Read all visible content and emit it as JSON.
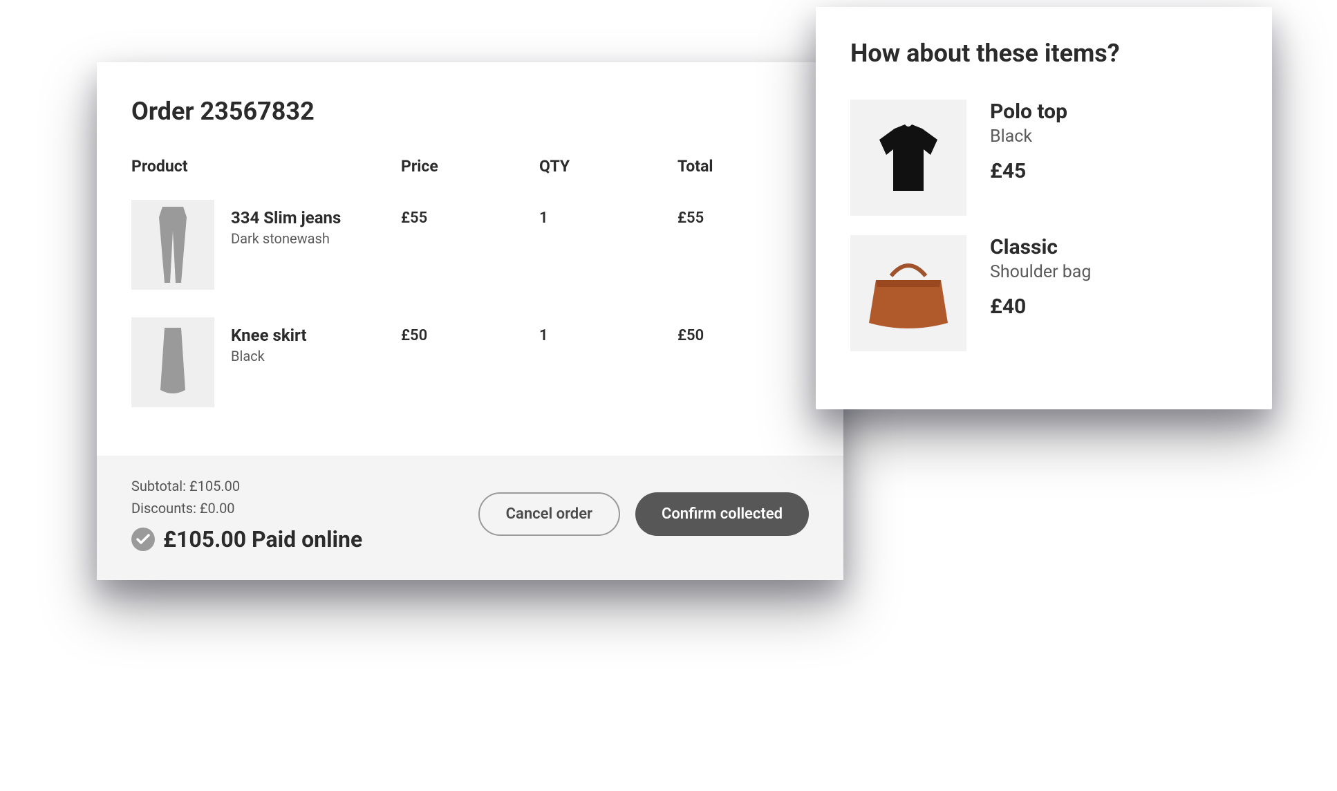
{
  "order": {
    "title": "Order 23567832",
    "columns": {
      "product": "Product",
      "price": "Price",
      "qty": "QTY",
      "total": "Total"
    },
    "items": [
      {
        "name": "334 Slim jeans",
        "variant": "Dark stonewash",
        "price": "£55",
        "qty": "1",
        "total": "£55"
      },
      {
        "name": "Knee skirt",
        "variant": "Black",
        "price": "£50",
        "qty": "1",
        "total": "£50"
      }
    ],
    "footer": {
      "subtotal": "Subtotal: £105.00",
      "discounts": "Discounts: £0.00",
      "paid": "£105.00 Paid online",
      "cancel": "Cancel order",
      "confirm": "Confirm collected"
    }
  },
  "suggestions": {
    "title": "How about these items?",
    "items": [
      {
        "name": "Polo top",
        "variant": "Black",
        "price": "£45"
      },
      {
        "name": "Classic",
        "variant": "Shoulder bag",
        "price": "£40"
      }
    ]
  }
}
